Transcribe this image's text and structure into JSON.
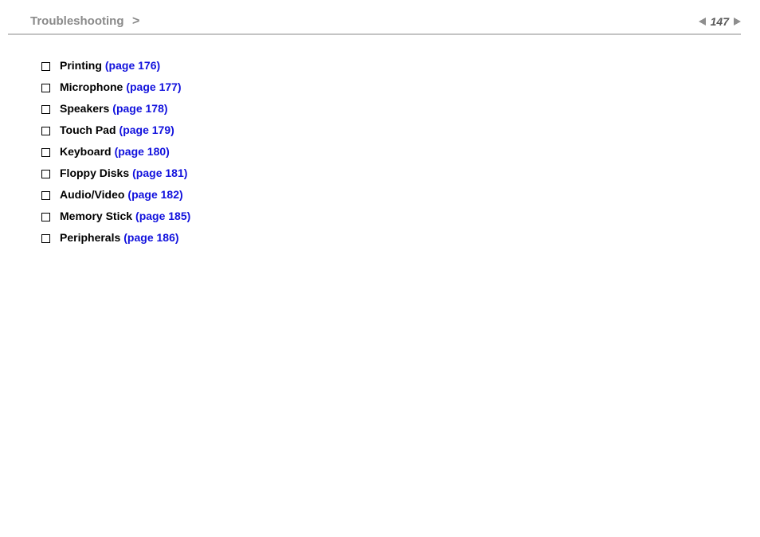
{
  "header": {
    "breadcrumb": "Troubleshooting",
    "breadcrumb_arrow": ">",
    "page_number": "147"
  },
  "items": [
    {
      "label": "Printing",
      "link": "(page 176)"
    },
    {
      "label": "Microphone",
      "link": "(page 177)"
    },
    {
      "label": "Speakers",
      "link": "(page 178)"
    },
    {
      "label": "Touch Pad",
      "link": "(page 179)"
    },
    {
      "label": "Keyboard",
      "link": "(page 180)"
    },
    {
      "label": "Floppy Disks",
      "link": "(page 181)"
    },
    {
      "label": "Audio/Video",
      "link": "(page 182)"
    },
    {
      "label": "Memory Stick",
      "link": "(page 185)"
    },
    {
      "label": "Peripherals",
      "link": "(page 186)"
    }
  ]
}
